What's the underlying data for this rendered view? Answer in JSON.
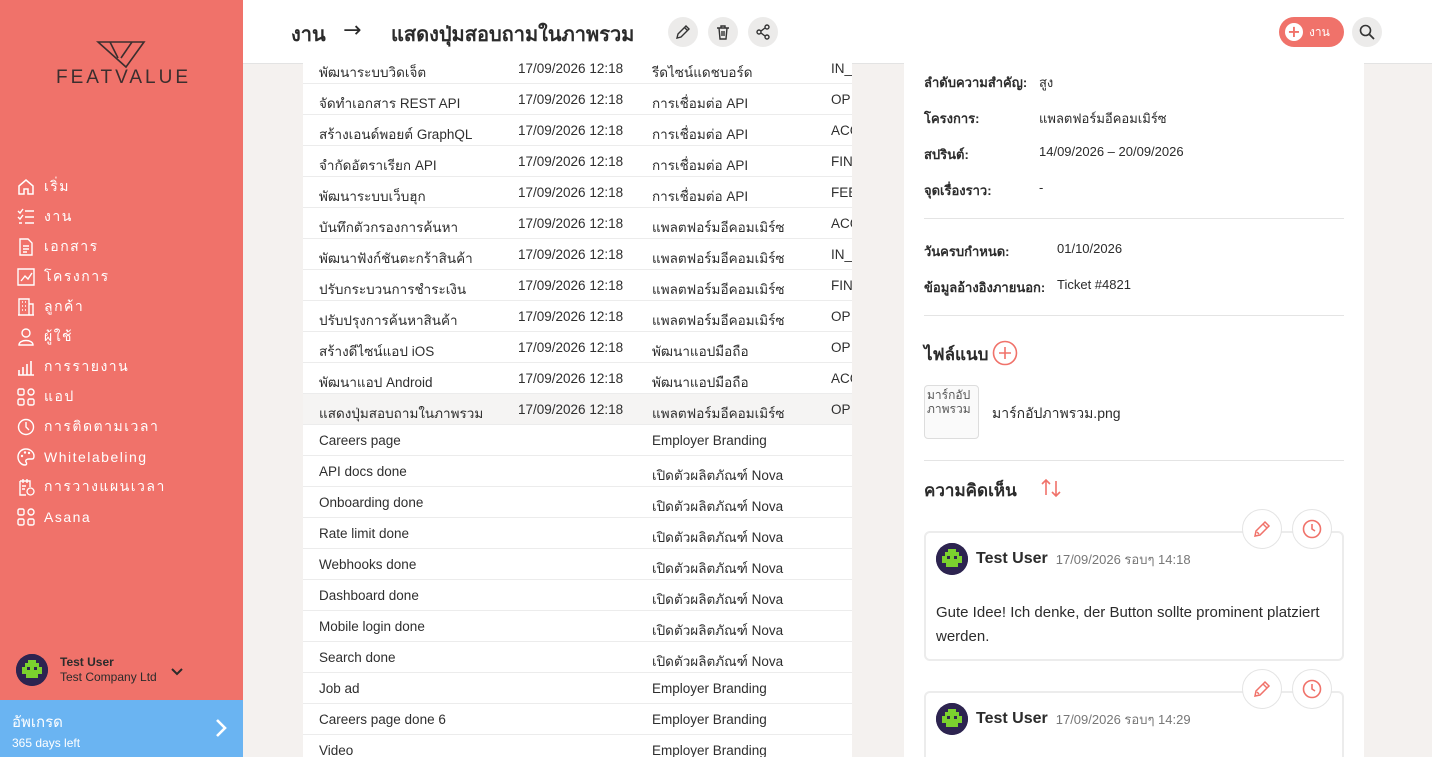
{
  "app": {
    "logo_text": "FEATVALUE"
  },
  "sidebar": {
    "items": [
      {
        "label": "เริ่ม",
        "icon": "home-icon"
      },
      {
        "label": "งาน",
        "icon": "tasks-icon"
      },
      {
        "label": "เอกสาร",
        "icon": "document-icon"
      },
      {
        "label": "โครงการ",
        "icon": "chart-icon"
      },
      {
        "label": "ลูกค้า",
        "icon": "building-icon"
      },
      {
        "label": "ผู้ใช้",
        "icon": "user-icon"
      },
      {
        "label": "การรายงาน",
        "icon": "bar-chart-icon"
      },
      {
        "label": "แอป",
        "icon": "apps-icon"
      },
      {
        "label": "การติดตามเวลา",
        "icon": "timer-icon"
      },
      {
        "label": "Whitelabeling",
        "icon": "palette-icon"
      },
      {
        "label": "การวางแผนเวลา",
        "icon": "calendar-icon"
      },
      {
        "label": "Asana",
        "icon": "apps-icon"
      }
    ],
    "user": {
      "name": "Test User",
      "company": "Test Company Ltd"
    },
    "upgrade": {
      "title": "อัพเกรด",
      "subtitle": "365 days left"
    }
  },
  "header": {
    "crumb_root": "งาน",
    "crumb_arrow": "→",
    "crumb_current": "แสดงปุ่มสอบถามในภาพรวม",
    "task_button": "งาน"
  },
  "table": {
    "rows": [
      {
        "title": "พัฒนาระบบวิดเจ็ต",
        "date": "17/09/2026 12:18",
        "project": "รีดไซน์แดชบอร์ด",
        "status": "IN_"
      },
      {
        "title": "จัดทำเอกสาร REST API",
        "date": "17/09/2026 12:18",
        "project": "การเชื่อมต่อ API",
        "status": "OP"
      },
      {
        "title": "สร้างเอนด์พอยต์ GraphQL",
        "date": "17/09/2026 12:18",
        "project": "การเชื่อมต่อ API",
        "status": "ACC"
      },
      {
        "title": "จำกัดอัตราเรียก API",
        "date": "17/09/2026 12:18",
        "project": "การเชื่อมต่อ API",
        "status": "FIN"
      },
      {
        "title": "พัฒนาระบบเว็บฮุก",
        "date": "17/09/2026 12:18",
        "project": "การเชื่อมต่อ API",
        "status": "FEE"
      },
      {
        "title": "บันทึกตัวกรองการค้นหา",
        "date": "17/09/2026 12:18",
        "project": "แพลตฟอร์มอีคอมเมิร์ซ",
        "status": "ACC"
      },
      {
        "title": "พัฒนาฟังก์ชันตะกร้าสินค้า",
        "date": "17/09/2026 12:18",
        "project": "แพลตฟอร์มอีคอมเมิร์ซ",
        "status": "IN_"
      },
      {
        "title": "ปรับกระบวนการชำระเงิน",
        "date": "17/09/2026 12:18",
        "project": "แพลตฟอร์มอีคอมเมิร์ซ",
        "status": "FIN"
      },
      {
        "title": "ปรับปรุงการค้นหาสินค้า",
        "date": "17/09/2026 12:18",
        "project": "แพลตฟอร์มอีคอมเมิร์ซ",
        "status": "OP"
      },
      {
        "title": "สร้างดีไซน์แอป iOS",
        "date": "17/09/2026 12:18",
        "project": "พัฒนาแอปมือถือ",
        "status": "OP"
      },
      {
        "title": "พัฒนาแอป Android",
        "date": "17/09/2026 12:18",
        "project": "พัฒนาแอปมือถือ",
        "status": "ACC"
      },
      {
        "title": "แสดงปุ่มสอบถามในภาพรวม",
        "date": "17/09/2026 12:18",
        "project": "แพลตฟอร์มอีคอมเมิร์ซ",
        "status": "OP"
      },
      {
        "title": "Careers page",
        "date": "",
        "project": "Employer Branding",
        "status": ""
      },
      {
        "title": "API docs done",
        "date": "",
        "project": "เปิดตัวผลิตภัณฑ์ Nova",
        "status": ""
      },
      {
        "title": "Onboarding done",
        "date": "",
        "project": "เปิดตัวผลิตภัณฑ์ Nova",
        "status": ""
      },
      {
        "title": "Rate limit done",
        "date": "",
        "project": "เปิดตัวผลิตภัณฑ์ Nova",
        "status": ""
      },
      {
        "title": "Webhooks done",
        "date": "",
        "project": "เปิดตัวผลิตภัณฑ์ Nova",
        "status": ""
      },
      {
        "title": "Dashboard done",
        "date": "",
        "project": "เปิดตัวผลิตภัณฑ์ Nova",
        "status": ""
      },
      {
        "title": "Mobile login done",
        "date": "",
        "project": "เปิดตัวผลิตภัณฑ์ Nova",
        "status": ""
      },
      {
        "title": "Search done",
        "date": "",
        "project": "เปิดตัวผลิตภัณฑ์ Nova",
        "status": ""
      },
      {
        "title": "Job ad",
        "date": "",
        "project": "Employer Branding",
        "status": ""
      },
      {
        "title": "Careers page done 6",
        "date": "",
        "project": "Employer Branding",
        "status": ""
      },
      {
        "title": "Video",
        "date": "",
        "project": "Employer Branding",
        "status": ""
      }
    ]
  },
  "detail": {
    "priority_label": "ลำดับความสำคัญ:",
    "priority_value": "สูง",
    "project_label": "โครงการ:",
    "project_value": "แพลตฟอร์มอีคอมเมิร์ซ",
    "sprint_label": "สปรินต์:",
    "sprint_value": "14/09/2026 – 20/09/2026",
    "story_label": "จุดเรื่องราว:",
    "story_value": "-",
    "due_label": "วันครบกำหนด:",
    "due_value": "01/10/2026",
    "external_label": "ข้อมูลอ้างอิงภายนอก:",
    "external_value": "Ticket #4821",
    "attachments_title": "ไฟล์แนบ",
    "attachment_alt": "มาร์กอัปภาพรวม",
    "attachment_name": "มาร์กอัปภาพรวม.png",
    "comments_title": "ความคิดเห็น",
    "comments": [
      {
        "user": "Test User",
        "time": "17/09/2026 รอบๆ 14:18",
        "text": "Gute Idee! Ich denke, der Button sollte prominent platziert werden."
      },
      {
        "user": "Test User",
        "time": "17/09/2026 รอบๆ 14:29",
        "text": ""
      }
    ]
  },
  "colors": {
    "accent": "#f0726a",
    "upgrade": "#6ab4f2"
  }
}
